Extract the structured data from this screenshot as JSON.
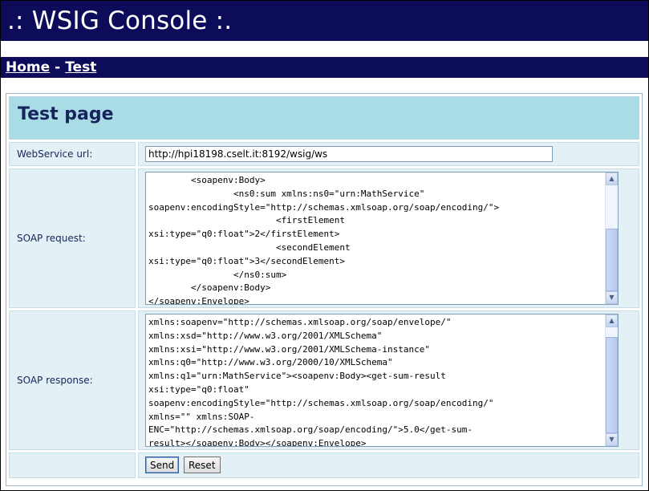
{
  "app": {
    "title": ".: WSIG Console :."
  },
  "nav": {
    "home": "Home",
    "separator": "-",
    "test": "Test"
  },
  "page": {
    "heading": "Test page"
  },
  "form": {
    "url_label": "WebService url:",
    "url_value": "http://hpi18198.cselt.it:8192/wsig/ws",
    "request_label": "SOAP request:",
    "request_text": "        <soapenv:Body>\n                <ns0:sum xmlns:ns0=\"urn:MathService\"\nsoapenv:encodingStyle=\"http://schemas.xmlsoap.org/soap/encoding/\">\n                        <firstElement\nxsi:type=\"q0:float\">2</firstElement>\n                        <secondElement\nxsi:type=\"q0:float\">3</secondElement>\n                </ns0:sum>\n        </soapenv:Body>\n</soapenv:Envelope>",
    "response_label": "SOAP response:",
    "response_text": "xmlns:soapenv=\"http://schemas.xmlsoap.org/soap/envelope/\"\nxmlns:xsd=\"http://www.w3.org/2001/XMLSchema\"\nxmlns:xsi=\"http://www.w3.org/2001/XMLSchema-instance\"\nxmlns:q0=\"http://www.w3.org/2000/10/XMLSchema\"\nxmlns:q1=\"urn:MathService\"><soapenv:Body><get-sum-result\nxsi:type=\"q0:float\"\nsoapenv:encodingStyle=\"http://schemas.xmlsoap.org/soap/encoding/\"\nxmlns=\"\" xmlns:SOAP-\nENC=\"http://schemas.xmlsoap.org/soap/encoding/\">5.0</get-sum-\nresult></soapenv:Body></soapenv:Envelope>",
    "send_label": "Send",
    "reset_label": "Reset"
  },
  "icons": {
    "scroll_up": "up-arrow-icon",
    "scroll_down": "down-arrow-icon"
  },
  "colors": {
    "header_bg": "#0c0c5a",
    "heading_bg": "#a9dce4",
    "label_bg": "#e3f1f6",
    "heading_text": "#16245c"
  }
}
